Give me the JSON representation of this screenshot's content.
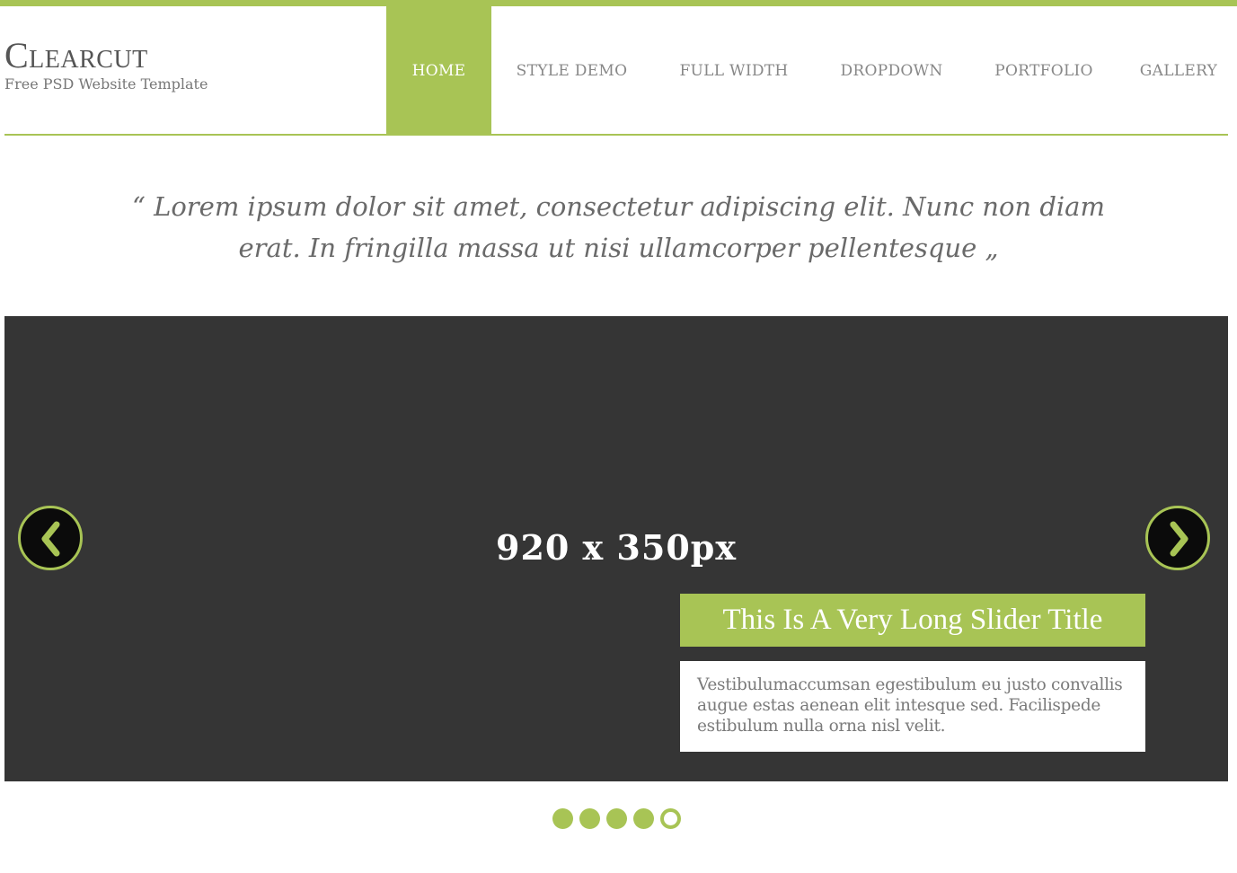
{
  "brand": {
    "title": "Clearcut",
    "subtitle": "Free PSD Website Template",
    "accent_color": "#a8c455",
    "dark_color": "#353535"
  },
  "nav": {
    "items": [
      {
        "label": "HOME",
        "active": true
      },
      {
        "label": "STYLE DEMO",
        "active": false
      },
      {
        "label": "FULL WIDTH",
        "active": false
      },
      {
        "label": "DROPDOWN",
        "active": false
      },
      {
        "label": "PORTFOLIO",
        "active": false
      },
      {
        "label": "GALLERY",
        "active": false
      }
    ]
  },
  "quote": {
    "text": "“ Lorem ipsum dolor sit amet, consectetur adipiscing elit. Nunc non diam erat. In fringilla massa ut nisi ullamcorper pellentesque „"
  },
  "slider": {
    "size_label": "920 x 350px",
    "caption_title": "This Is A Very Long Slider Title",
    "caption_body": "Vestibulumaccumsan egestibulum eu justo convallis augue estas aenean elit intesque sed. Facilispede estibulum nulla orna nisl velit.",
    "prev_icon": "chevron-left-icon",
    "next_icon": "chevron-right-icon",
    "dots": [
      {
        "active": false
      },
      {
        "active": false
      },
      {
        "active": false
      },
      {
        "active": false
      },
      {
        "active": true
      }
    ]
  }
}
